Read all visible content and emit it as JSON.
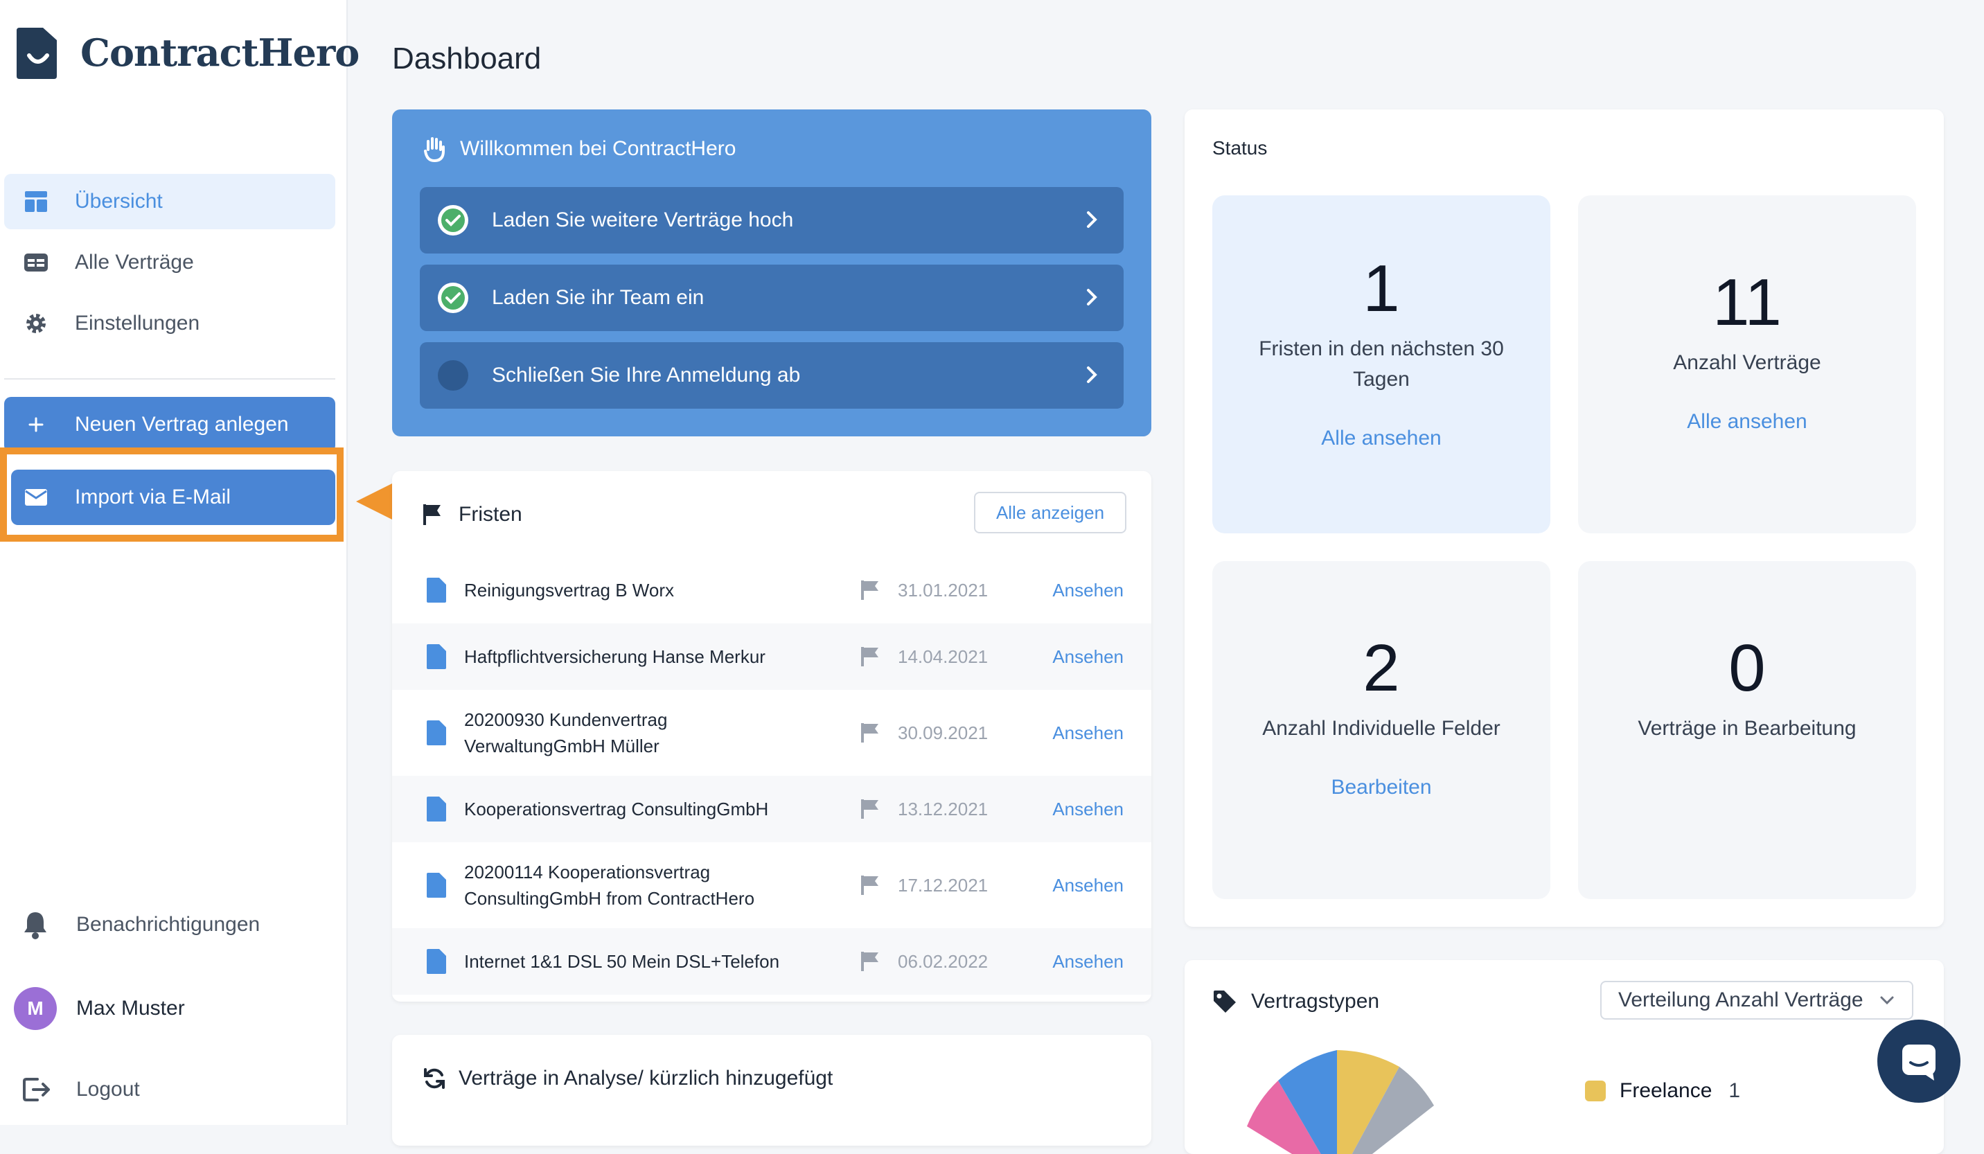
{
  "app": {
    "name": "ContractHero"
  },
  "sidebar": {
    "items": [
      {
        "label": "Übersicht",
        "icon": "dashboard-icon"
      },
      {
        "label": "Alle Verträge",
        "icon": "contracts-list-icon"
      },
      {
        "label": "Einstellungen",
        "icon": "gear-icon"
      }
    ],
    "new_contract_label": "Neuen Vertrag anlegen",
    "import_email_label": "Import via E-Mail",
    "notifications_label": "Benachrichtigungen",
    "user": {
      "initial": "M",
      "name": "Max Muster"
    },
    "logout_label": "Logout"
  },
  "page": {
    "title": "Dashboard"
  },
  "welcome": {
    "title": "Willkommen bei ContractHero",
    "tasks": [
      {
        "label": "Laden Sie weitere Verträge hoch",
        "done": true
      },
      {
        "label": "Laden Sie ihr Team ein",
        "done": true
      },
      {
        "label": "Schließen Sie Ihre Anmeldung ab",
        "done": false
      }
    ]
  },
  "deadlines": {
    "title": "Fristen",
    "show_all_label": "Alle anzeigen",
    "link_label": "Ansehen",
    "rows": [
      {
        "name1": "Reinigungsvertrag B Worx",
        "name2": "",
        "date": "31.01.2021"
      },
      {
        "name1": "Haftpflichtversicherung Hanse Merkur",
        "name2": "",
        "date": "14.04.2021"
      },
      {
        "name1": "20200930 Kundenvertrag",
        "name2": "VerwaltungGmbH Müller",
        "date": "30.09.2021"
      },
      {
        "name1": "Kooperationsvertrag ConsultingGmbH",
        "name2": "",
        "date": "13.12.2021"
      },
      {
        "name1": "20200114 Kooperationsvertrag",
        "name2": "ConsultingGmbH from ContractHero",
        "date": "17.12.2021"
      },
      {
        "name1": "Internet 1&1 DSL 50 Mein DSL+Telefon",
        "name2": "",
        "date": "06.02.2022"
      }
    ]
  },
  "analysis": {
    "title": "Verträge in Analyse/ kürzlich hinzugefügt"
  },
  "status": {
    "title": "Status",
    "tiles": [
      {
        "value": "1",
        "line1": "Fristen in den nächsten 30",
        "line2": "Tagen",
        "link": "Alle ansehen"
      },
      {
        "value": "11",
        "line1": "Anzahl Verträge",
        "line2": "",
        "link": "Alle ansehen"
      },
      {
        "value": "2",
        "line1": "Anzahl Individuelle Felder",
        "line2": "",
        "link": "Bearbeiten"
      },
      {
        "value": "0",
        "line1": "Verträge in Bearbeitung",
        "line2": "",
        "link": ""
      }
    ]
  },
  "contract_types": {
    "title": "Vertragstypen",
    "select_value": "Verteilung Anzahl Verträge",
    "legend": [
      {
        "label": "Freelance",
        "count": "1",
        "color": "#e8c35a"
      }
    ],
    "pie_colors": [
      "#e86aa6",
      "#4a8fdf",
      "#e8c35a",
      "#a3aab6"
    ]
  },
  "colors": {
    "accent": "#4a8fdf",
    "primary_button": "#4a85d4",
    "welcome_bg": "#5a97dc",
    "highlight": "#f0952e"
  }
}
